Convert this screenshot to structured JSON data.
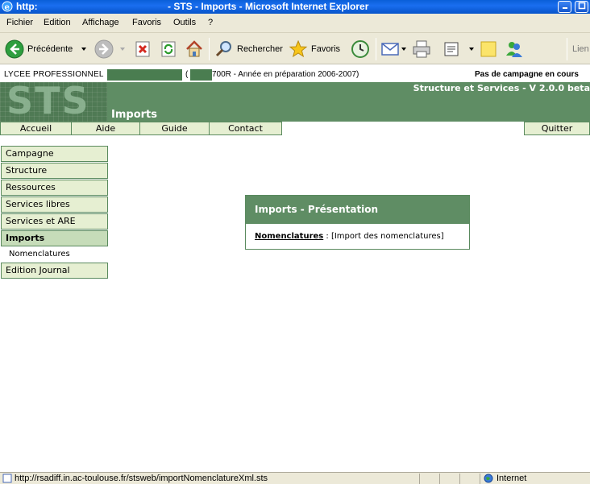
{
  "window": {
    "title_left": "http:",
    "title_center": "- STS - Imports - Microsoft Internet Explorer",
    "controls": [
      "minimize-icon",
      "maximize-icon"
    ]
  },
  "menubar": {
    "items": [
      "Fichier",
      "Edition",
      "Affichage",
      "Favoris",
      "Outils",
      "?"
    ]
  },
  "toolbar": {
    "back_label": "Précédente",
    "search_label": "Rechercher",
    "favorites_label": "Favoris",
    "links_label": "Lien"
  },
  "info": {
    "establishment": "LYCEE PROFESSIONNEL",
    "paren_open": "(",
    "code_suffix": "700R - Année en préparation 2006-2007)",
    "campaign": "Pas de campagne en cours"
  },
  "banner": {
    "logo": "STS",
    "section": "Imports",
    "version": "Structure et Services - V 2.0.0 beta"
  },
  "topnav": {
    "items": [
      "Accueil",
      "Aide",
      "Guide",
      "Contact"
    ],
    "quit": "Quitter"
  },
  "sidebar": {
    "items": [
      "Campagne",
      "Structure",
      "Ressources",
      "Services libres",
      "Services et ARE",
      "Imports"
    ],
    "active": "Imports",
    "subitem": "Nomenclatures",
    "last": "Edition Journal"
  },
  "panel": {
    "title": "Imports - Présentation",
    "link": "Nomenclatures",
    "desc": " : [Import des nomenclatures]"
  },
  "status": {
    "url": "http://rsadiff.in.ac-toulouse.fr/stsweb/importNomenclatureXml.sts",
    "zone": "Internet"
  },
  "colors": {
    "banner": "#5f8d64",
    "nav_bg": "#e6efd2",
    "nav_border": "#5a8a5e",
    "chrome": "#ece9d8"
  }
}
